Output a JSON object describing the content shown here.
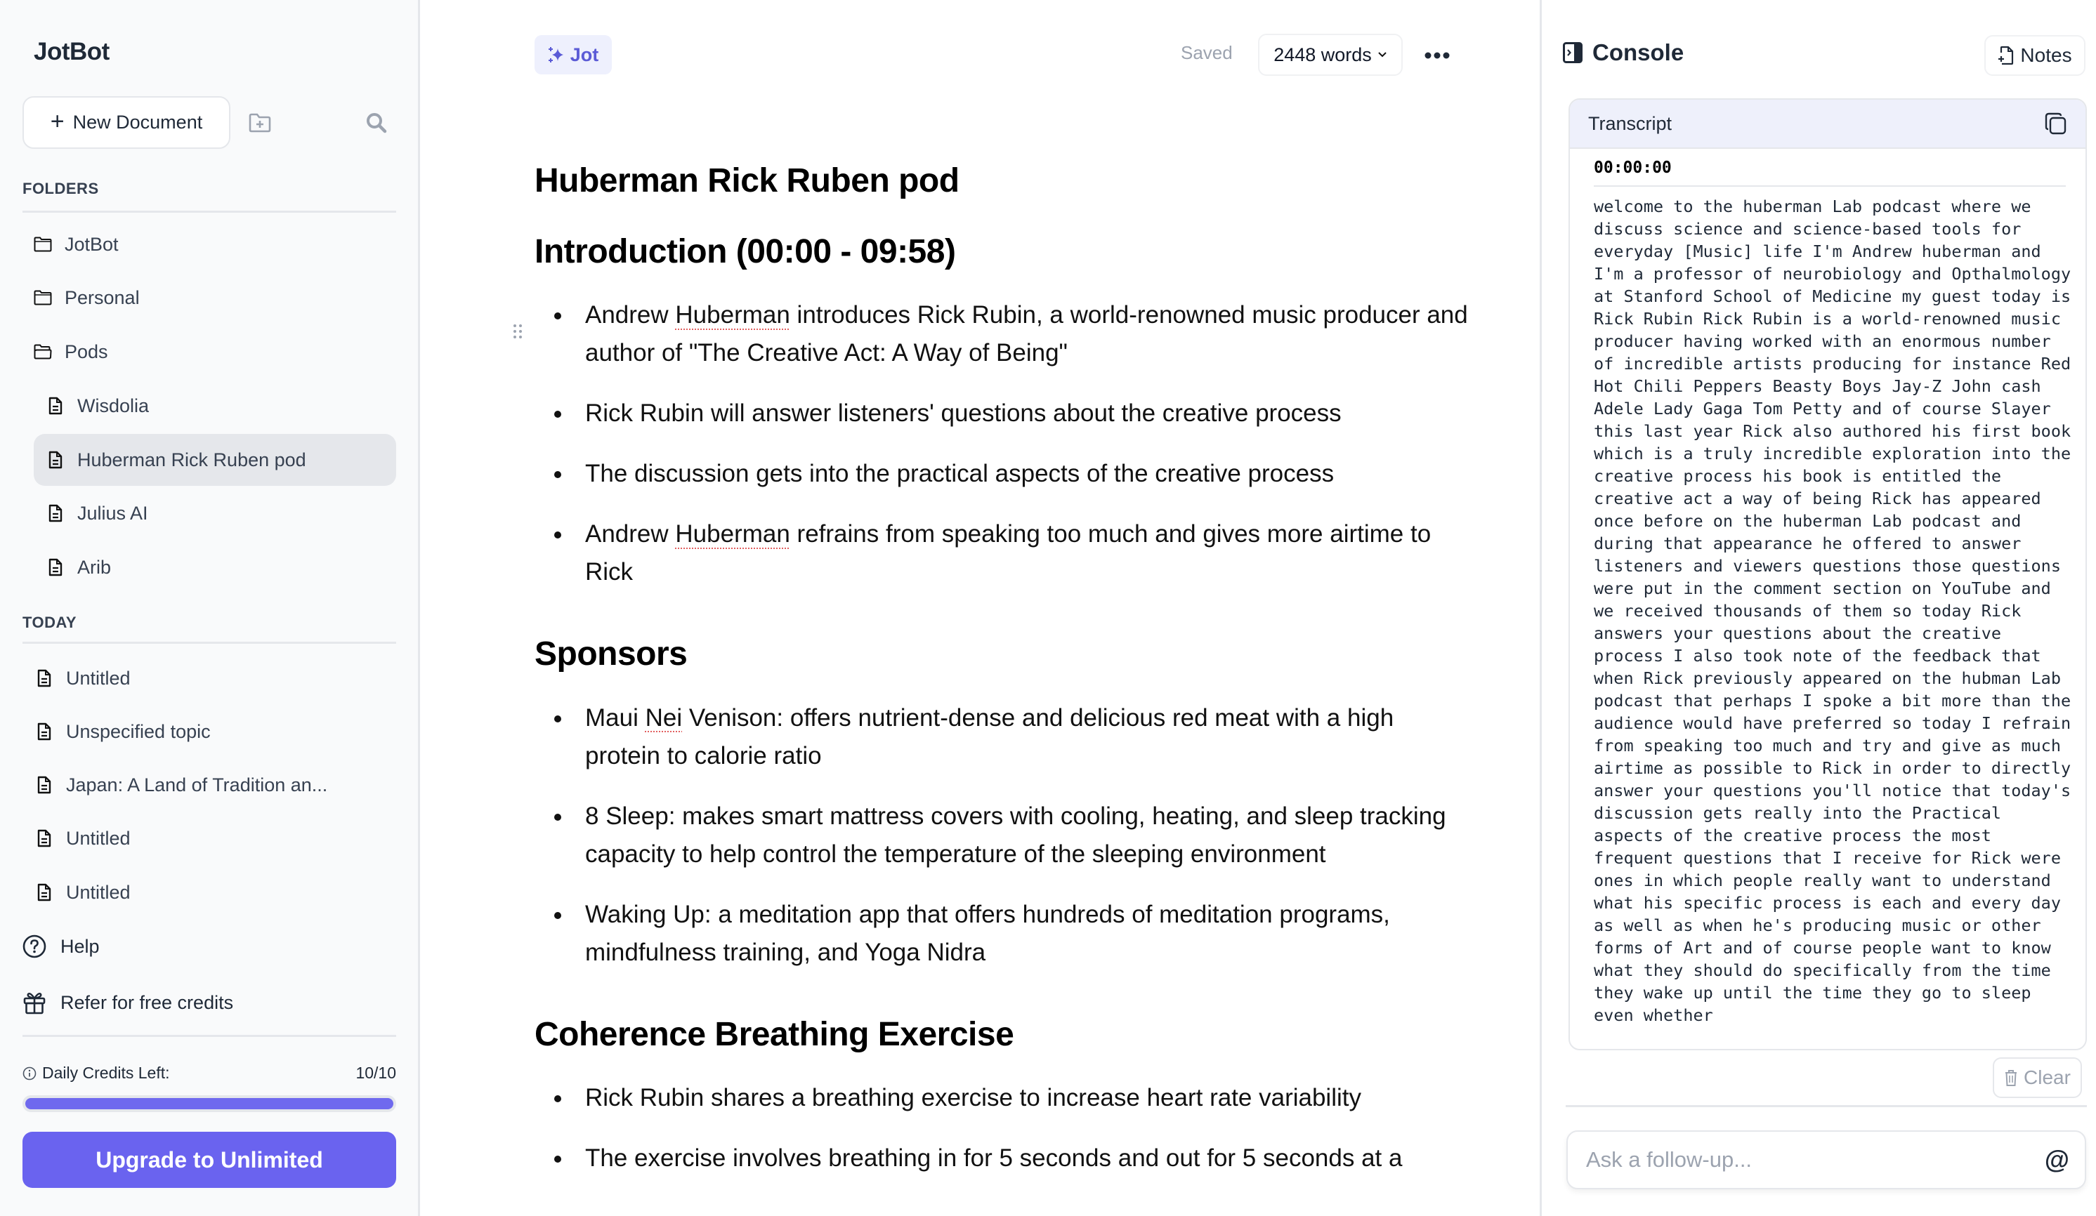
{
  "sidebar": {
    "brand": "JotBot",
    "new_document_label": "New Document",
    "folders_label": "FOLDERS",
    "folders": [
      {
        "label": "JotBot",
        "icon": "folder-icon"
      },
      {
        "label": "Personal",
        "icon": "folder-icon"
      },
      {
        "label": "Pods",
        "icon": "folder-open-icon",
        "open": true
      }
    ],
    "pod_docs": [
      {
        "label": "Wisdolia"
      },
      {
        "label": "Huberman Rick Ruben pod",
        "active": true
      },
      {
        "label": "Julius AI"
      },
      {
        "label": "Arib"
      }
    ],
    "today_label": "TODAY",
    "today_docs": [
      {
        "label": "Untitled"
      },
      {
        "label": "Unspecified topic"
      },
      {
        "label": "Japan: A Land of Tradition an..."
      },
      {
        "label": "Untitled"
      },
      {
        "label": "Untitled"
      }
    ],
    "help_label": "Help",
    "refer_label": "Refer for free credits",
    "credits_label": "Daily Credits Left:",
    "credits_value": "10/10",
    "credits_fraction": 1.0,
    "upgrade_label": "Upgrade to Unlimited",
    "accent_color": "#6a63ef"
  },
  "toolbar": {
    "jot_label": "Jot",
    "saved_label": "Saved",
    "word_count_label": "2448 words"
  },
  "document": {
    "title": "Huberman Rick Ruben pod",
    "sections": [
      {
        "heading": "Introduction (00:00 - 09:58)",
        "bullets": [
          [
            "Andrew ",
            {
              "spell": "Huberman"
            },
            " introduces Rick Rubin, a world-renowned music producer and author of \"The Creative Act: A Way of Being\""
          ],
          [
            "Rick Rubin will answer listeners' questions about the creative process"
          ],
          [
            "The discussion gets into the practical aspects of the creative process"
          ],
          [
            "Andrew ",
            {
              "spell": "Huberman"
            },
            " refrains from speaking too much and gives more airtime to Rick"
          ]
        ]
      },
      {
        "heading": "Sponsors",
        "bullets": [
          [
            "Maui ",
            {
              "spell": "Nei"
            },
            " Venison: offers nutrient-dense and delicious red meat with a high protein to calorie ratio"
          ],
          [
            "8 Sleep: makes smart mattress covers with cooling, heating, and sleep tracking capacity to help control the temperature of the sleeping environment"
          ],
          [
            "Waking Up: a meditation app that offers hundreds of meditation programs, mindfulness training, and Yoga Nidra"
          ]
        ]
      },
      {
        "heading": "Coherence Breathing Exercise",
        "bullets": [
          [
            "Rick Rubin shares a breathing exercise to increase heart rate variability"
          ],
          [
            "The exercise involves breathing in for 5 seconds and out for 5 seconds at a"
          ]
        ]
      }
    ]
  },
  "console": {
    "title": "Console",
    "notes_label": "Notes",
    "transcript_label": "Transcript",
    "timestamp": "00:00:00",
    "transcript_text": "welcome to the huberman Lab podcast where we discuss science and science-based tools for everyday [Music] life I'm Andrew huberman and I'm a professor of neurobiology and Opthalmology at Stanford School of Medicine my guest today is Rick Rubin Rick Rubin is a world-renowned music producer having worked with an enormous number of incredible artists producing for instance Red Hot Chili Peppers Beasty Boys Jay-Z John cash Adele Lady Gaga Tom Petty and of course Slayer this last year Rick also authored his first book which is a truly incredible exploration into the creative process his book is entitled the creative act a way of being Rick has appeared once before on the huberman Lab podcast and during that appearance he offered to answer listeners and viewers questions those questions were put in the comment section on YouTube and we received thousands of them so today Rick answers your questions about the creative process I also took note of the feedback that when Rick previously appeared on the hubman Lab podcast that perhaps I spoke a bit more than the audience would have preferred so today I refrain from speaking too much and try and give as much airtime as possible to Rick in order to directly answer your questions you'll notice that today's discussion gets really into the Practical aspects of the creative process the most frequent questions that I receive for Rick were ones in which people really want to understand what his specific process is each and every day as well as when he's producing music or other forms of Art and of course people want to know what they should do specifically from the time they wake up until the time they go to sleep even whether",
    "clear_label": "Clear",
    "ask_placeholder": "Ask a follow-up...",
    "mention_symbol": "@"
  }
}
